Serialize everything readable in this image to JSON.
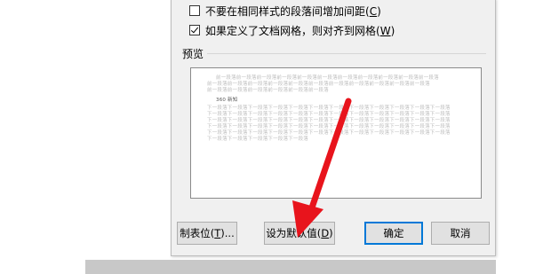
{
  "options": {
    "dont_add_space": {
      "text_before": "不要在相同样式的段落间增加间距(",
      "mnemonic": "C",
      "text_after": ")",
      "checked": false
    },
    "snap_to_grid": {
      "text_before": "如果定义了文档网格，则对齐到网格(",
      "mnemonic": "W",
      "text_after": ")",
      "checked": true
    }
  },
  "preview": {
    "label": "预览",
    "prev_paragraph": [
      "前一段落前一段落前一段落前一段落前一段落前一段落前一段落前一段落前一段落前一段落前一段落",
      "前一段落前一段落前一段落前一段落前一段落前一段落前一段落前一段落前一段落前一段落前一段落",
      "前一段落前一段落前一段落前一段落前一段落前一段落"
    ],
    "sample_text": "360 新知",
    "next_paragraph": [
      "下一段落下一段落下一段落下一段落下一段落下一段落下一段落下一段落下一段落下一段落下一段落下一段落",
      "下一段落下一段落下一段落下一段落下一段落下一段落下一段落下一段落下一段落下一段落下一段落下一段落",
      "下一段落下一段落下一段落下一段落下一段落下一段落下一段落下一段落下一段落下一段落下一段落下一段落",
      "下一段落下一段落下一段落下一段落下一段落下一段落下一段落下一段落下一段落下一段落下一段落下一段落",
      "下一段落下一段落下一段落下一段落下一段落下一段落下一段落下一段落下一段落下一段落下一段落下一段落",
      "下一段落下一段落下一段落下一段落下一段落"
    ]
  },
  "buttons": {
    "tabs": {
      "text_before": "制表位(",
      "mnemonic": "T",
      "text_after": ")..."
    },
    "set_default": {
      "text_before": "设为默认值(",
      "mnemonic": "D",
      "text_after": ")"
    },
    "ok": {
      "text": "确定"
    },
    "cancel": {
      "text": "取消"
    }
  },
  "colors": {
    "arrow": "#e8141c",
    "default_button_border": "#0078d7"
  },
  "icons": {
    "annotation": "red-arrow-icon"
  }
}
